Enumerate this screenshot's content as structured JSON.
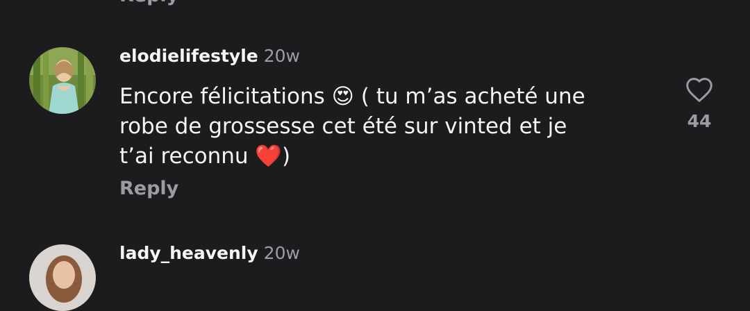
{
  "previous": {
    "reply_label": "Reply"
  },
  "comments": [
    {
      "username": "elodielifestyle",
      "time": "20w",
      "text": "Encore félicitations 😍 ( tu m’as acheté une\nrobe de grossesse cet été sur vinted et je\nt’ai reconnu ❤️)",
      "reply_label": "Reply",
      "likes": "44"
    },
    {
      "username": "lady_heavenly",
      "time": "20w"
    }
  ],
  "colors": {
    "background": "#1c1c1f",
    "primary_text": "#f5f5f5",
    "secondary_text": "#9c9ca3"
  },
  "icons": [
    "heart-outline-icon"
  ]
}
